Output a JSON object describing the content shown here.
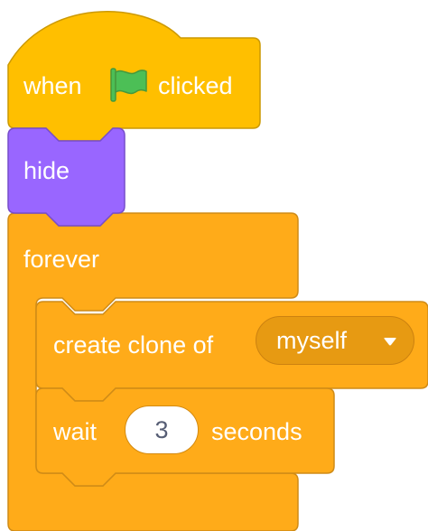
{
  "colors": {
    "events": "#ffbf00",
    "events_border": "#cc9900",
    "looks": "#9966ff",
    "looks_border": "#774dcb",
    "control": "#ffab19",
    "control_border": "#cf8b17",
    "flag_green": "#4cbf56",
    "flag_border": "#45993d"
  },
  "hat_block": {
    "label_before": "when",
    "icon": "green-flag-icon",
    "label_after": "clicked"
  },
  "hide_block": {
    "label": "hide"
  },
  "forever_block": {
    "label": "forever"
  },
  "create_clone_block": {
    "label": "create clone of",
    "dropdown_value": "myself",
    "dropdown_icon": "caret-down-icon"
  },
  "wait_block": {
    "label_before": "wait",
    "input_value": "3",
    "label_after": "seconds"
  }
}
